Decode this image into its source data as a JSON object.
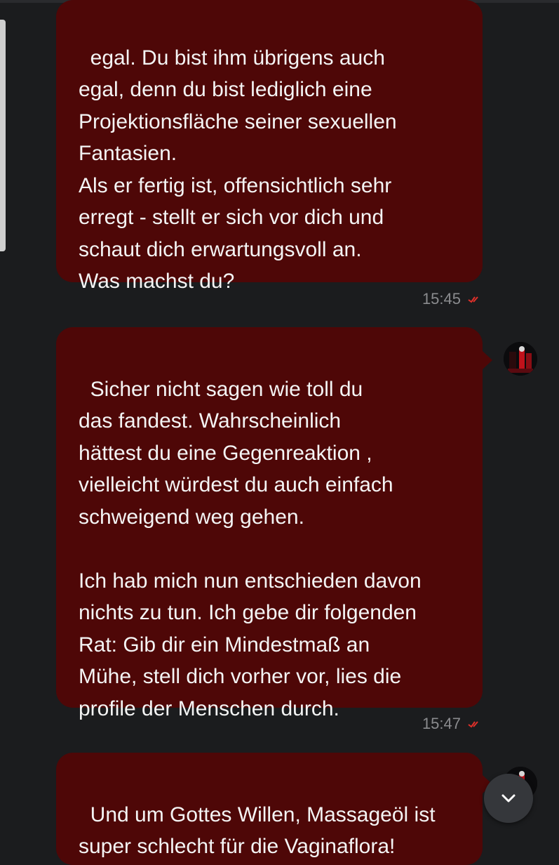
{
  "messages": [
    {
      "text": "egal. Du bist ihm übrigens auch\negal, denn du bist lediglich eine\nProjektionsfläche seiner sexuellen\nFantasien.\nAls er fertig ist, offensichtlich sehr\nerregt - stellt er sich vor dich und\nschaut dich erwartungsvoll an.\nWas machst du?",
      "time": "15:45",
      "status_icon": "double-check-icon"
    },
    {
      "text": "Sicher nicht sagen wie toll du\ndas fandest. Wahrscheinlich\nhättest du eine Gegenreaktion ,\nvielleicht würdest du auch einfach\nschweigend weg gehen.\n\nIch hab mich nun entschieden davon\nnichts zu tun. Ich gebe dir folgenden\nRat: Gib dir ein Mindestmaß an\nMühe, stell dich vorher vor, lies die\nprofile der Menschen durch.",
      "time": "15:47",
      "status_icon": "double-check-icon"
    },
    {
      "text": "Und um Gottes Willen, Massageöl ist\nsuper schlecht für die Vaginaflora!",
      "status_icon": "double-check-icon"
    }
  ],
  "colors": {
    "background": "#1b1c1e",
    "bubble": "#4e0707",
    "text": "#f4f4f4",
    "timestamp": "#8a8b8e",
    "tick": "#e0302a"
  },
  "icons": {
    "scroll_down": "chevron-down-icon",
    "avatar": "avatar"
  }
}
